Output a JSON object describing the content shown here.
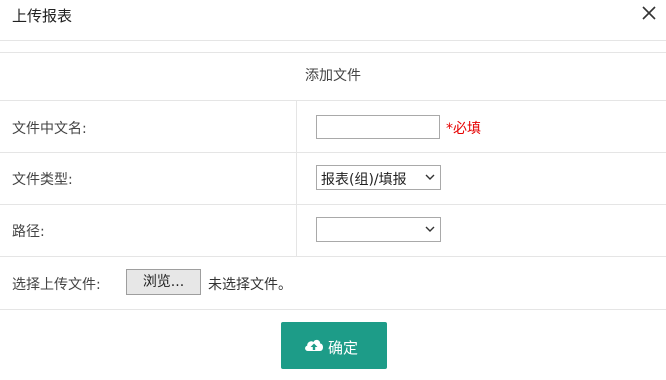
{
  "dialog": {
    "title": "上传报表",
    "close_icon": "close-icon"
  },
  "form": {
    "section_title": "添加文件",
    "file_name": {
      "label": "文件中文名:",
      "value": "",
      "required_note": "*必填"
    },
    "file_type": {
      "label": "文件类型:",
      "selected": "报表(组)/填报"
    },
    "path": {
      "label": "路径:",
      "selected": ""
    },
    "upload": {
      "label": "选择上传文件:",
      "browse_label": "浏览...",
      "status": "未选择文件。"
    }
  },
  "actions": {
    "confirm_label": "确定",
    "confirm_icon": "cloud-upload-icon",
    "color": "#1d9c88"
  },
  "colors": {
    "required": "#e60000",
    "border": "#e5e5e5"
  }
}
